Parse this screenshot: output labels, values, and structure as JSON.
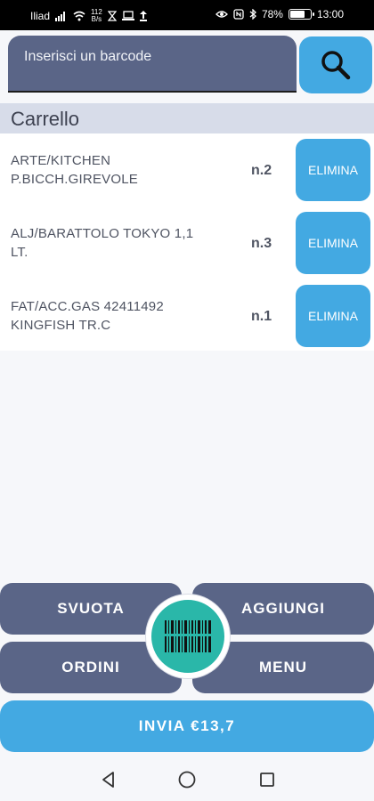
{
  "status_bar": {
    "carrier": "Iliad",
    "speed_value": "112",
    "speed_unit": "B/s",
    "battery": "78%",
    "battery_level": 0.78,
    "time": "13:00"
  },
  "search": {
    "placeholder": "Inserisci un barcode",
    "button_icon": "search-icon"
  },
  "cart": {
    "title": "Carrello",
    "items": [
      {
        "name_line1": "ARTE/KITCHEN",
        "name_line2": "P.BICCH.GIREVOLE",
        "qty": "n.2",
        "delete_label": "ELIMINA"
      },
      {
        "name_line1": "ALJ/BARATTOLO TOKYO 1,1",
        "name_line2": "LT.",
        "qty": "n.3",
        "delete_label": "ELIMINA"
      },
      {
        "name_line1": "FAT/ACC.GAS 42411492",
        "name_line2": "KINGFISH TR.C",
        "qty": "n.1",
        "delete_label": "ELIMINA"
      }
    ]
  },
  "actions": {
    "clear_label": "SVUOTA",
    "add_label": "AGGIUNGI",
    "orders_label": "ORDINI",
    "menu_label": "MENU",
    "scan_icon": "barcode-icon",
    "send_label": "INVIA €13,7"
  },
  "colors": {
    "primary_dark": "#5a6587",
    "accent_blue": "#43a9e2",
    "scan_teal": "#2ab7a9",
    "header_bg": "#d7dce9"
  },
  "nav": {
    "back_icon": "back-triangle-icon",
    "home_icon": "home-circle-icon",
    "recents_icon": "recents-square-icon"
  }
}
